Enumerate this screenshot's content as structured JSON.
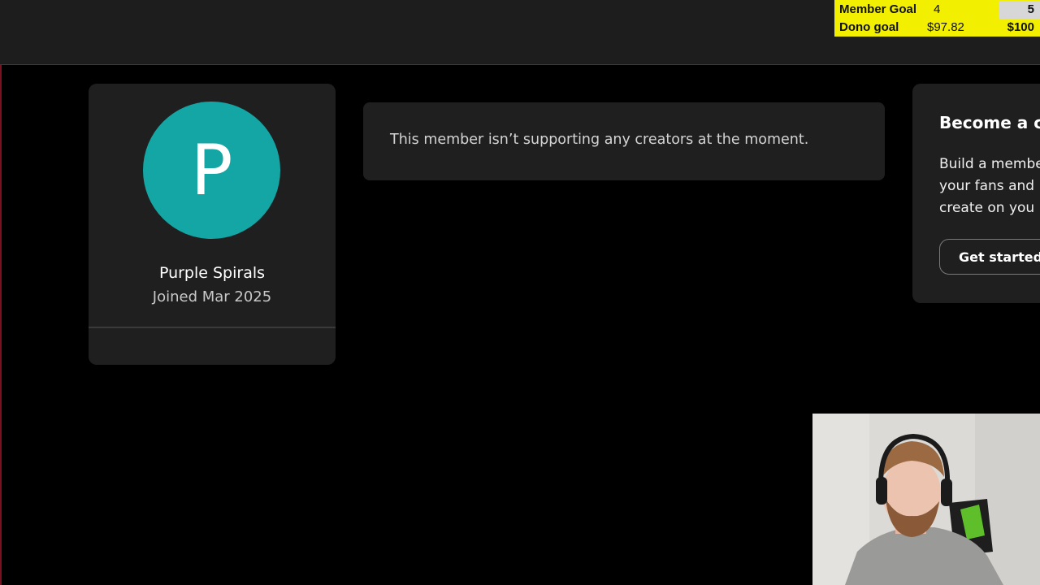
{
  "goals": {
    "member": {
      "label": "Member Goal",
      "current": "4",
      "target": "5"
    },
    "dono": {
      "label": "Dono goal",
      "current": "$97.82",
      "target": "$100"
    }
  },
  "profile": {
    "initial": "P",
    "name": "Purple Spirals",
    "joined": "Joined Mar 2025"
  },
  "message": "This member isn’t supporting any creators at the moment.",
  "creator_promo": {
    "title": "Become a cr",
    "lines": [
      "Build a membe",
      "your fans and",
      "create on you"
    ],
    "button_label": "Get started"
  },
  "colors": {
    "background": "#000000",
    "card": "#1f1f1f",
    "avatar": "#14a6a4",
    "goal_bar": "#f2ef00"
  }
}
